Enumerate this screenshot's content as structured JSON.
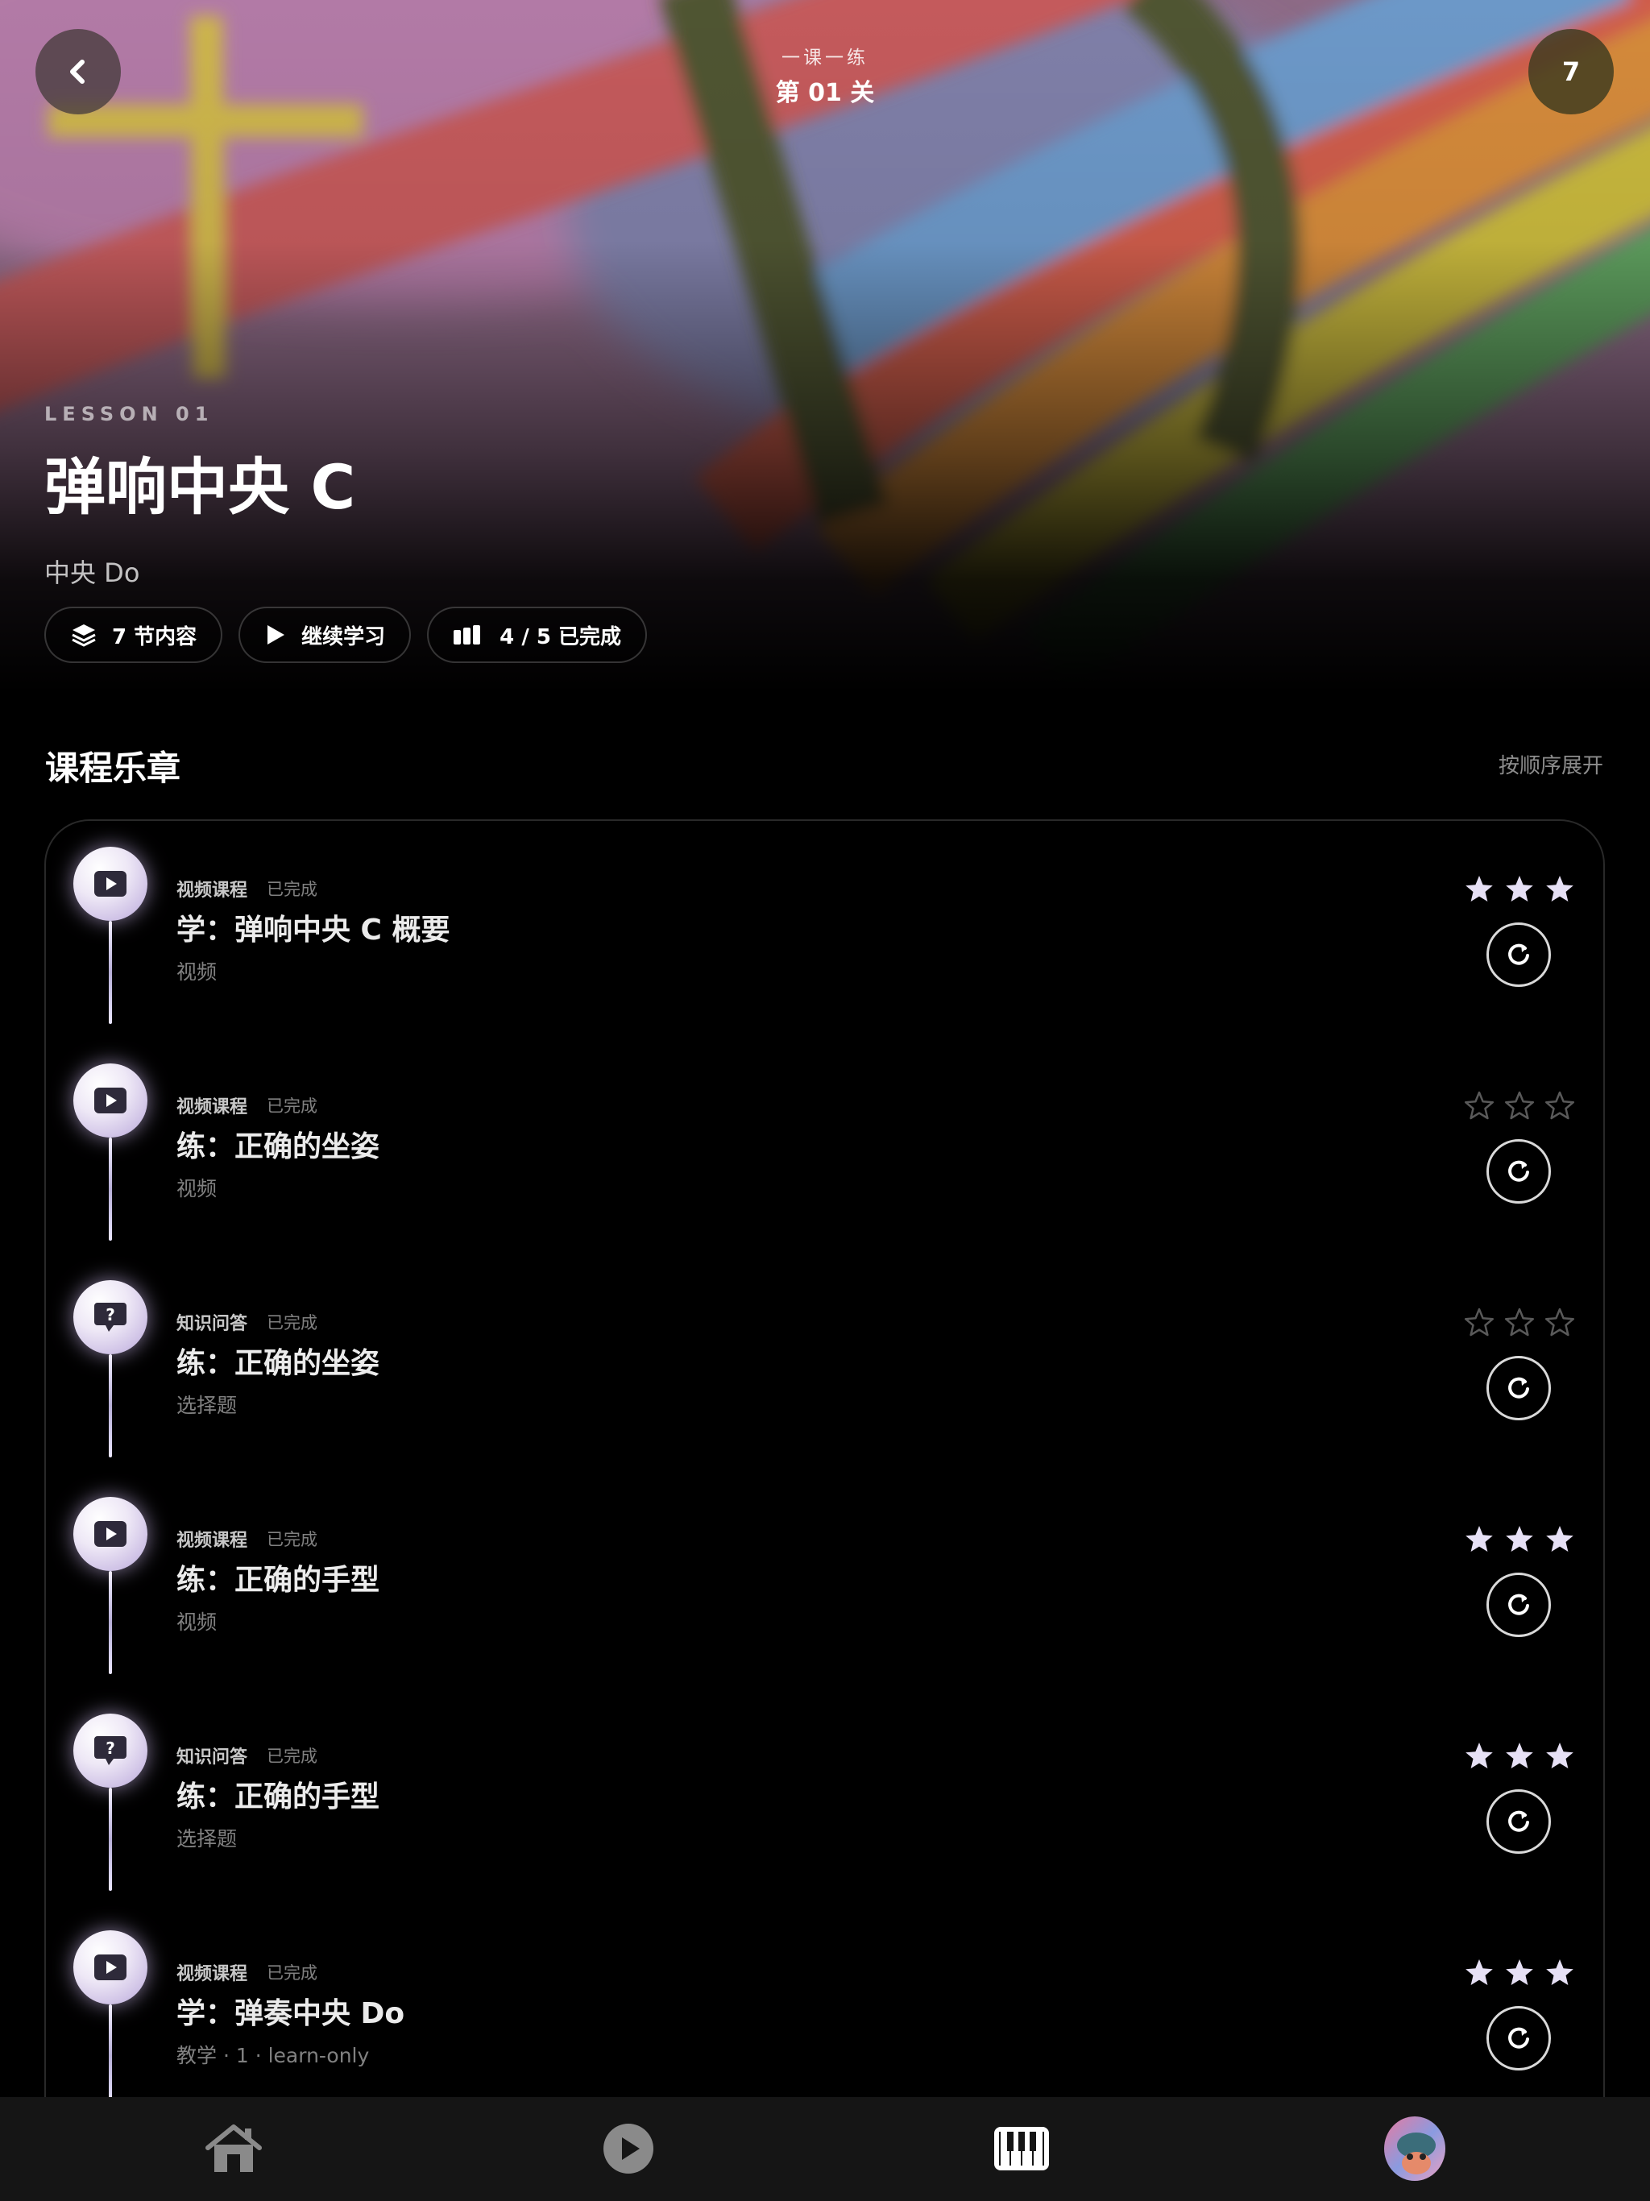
{
  "header": {
    "subtitle": "一课一练",
    "title": "第 01 关",
    "badge": "7"
  },
  "lesson": {
    "kicker": "LESSON 01",
    "title": "弹响中央 C",
    "subtitle": "中央 Do",
    "pills": {
      "sections": "7 节内容",
      "continue": "继续学习",
      "progress": "4 / 5 已完成"
    }
  },
  "section": {
    "title": "课程乐章",
    "action": "按顺序展开"
  },
  "items": [
    {
      "kind": "视频课程",
      "status": "已完成",
      "title": "学：弹响中央 C 概要",
      "sub": "视频",
      "icon": "play-icon",
      "stars": 3
    },
    {
      "kind": "视频课程",
      "status": "已完成",
      "title": "练：正确的坐姿",
      "sub": "视频",
      "icon": "play-icon",
      "stars": 0
    },
    {
      "kind": "知识问答",
      "status": "已完成",
      "title": "练：正确的坐姿",
      "sub": "选择题",
      "icon": "question-icon",
      "stars": 0
    },
    {
      "kind": "视频课程",
      "status": "已完成",
      "title": "练：正确的手型",
      "sub": "视频",
      "icon": "play-icon",
      "stars": 3
    },
    {
      "kind": "知识问答",
      "status": "已完成",
      "title": "练：正确的手型",
      "sub": "选择题",
      "icon": "question-icon",
      "stars": 3
    },
    {
      "kind": "视频课程",
      "status": "已完成",
      "title": "学：弹奏中央 Do",
      "sub": "教学 · 1 · learn-only",
      "icon": "play-icon",
      "stars": 3
    }
  ],
  "tabbar": [
    "home-icon",
    "play-circle-icon",
    "piano-icon",
    "avatar"
  ],
  "colors": {
    "background": "#000000",
    "star_filled": "#e6e0f5",
    "node_glow": "#cfc2e6",
    "tabbar": "#151515"
  }
}
